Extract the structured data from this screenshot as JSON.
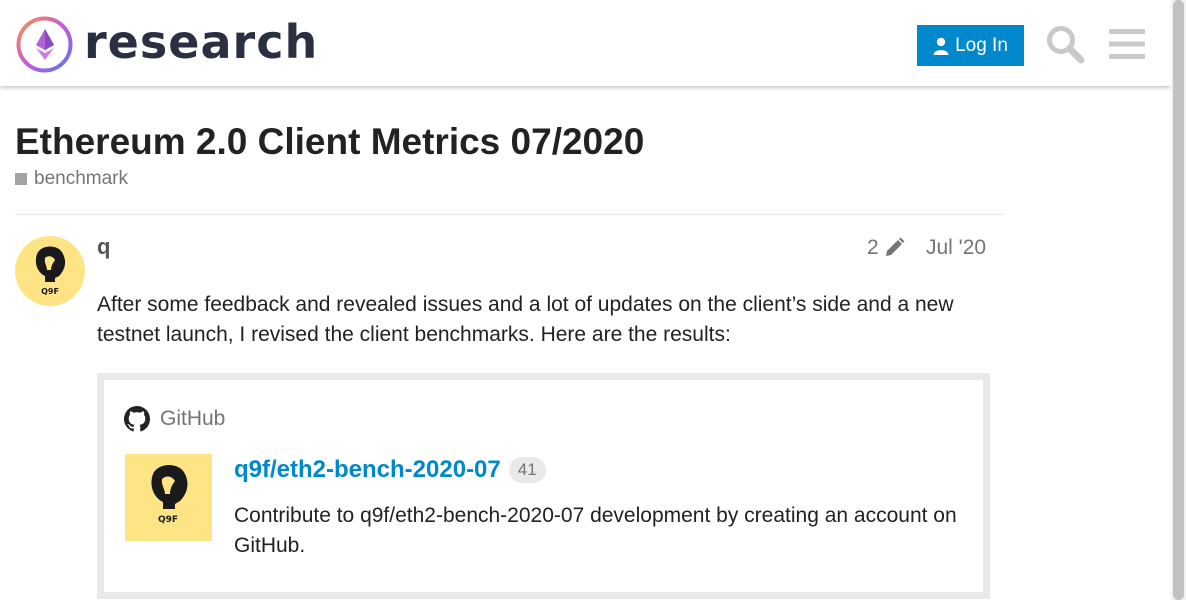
{
  "header": {
    "logo_text": "research",
    "login_label": "Log In",
    "icons": {
      "logo": "ethereum-research-logo",
      "user": "user-icon",
      "search": "search-icon",
      "menu": "hamburger-menu-icon"
    }
  },
  "topic": {
    "title": "Ethereum 2.0 Client Metrics 07/2020",
    "category": "benchmark",
    "category_color": "#a3a3a3"
  },
  "post": {
    "username": "q",
    "edit_count": "2",
    "date": "Jul '20",
    "body": "After some feedback and revealed issues and a lot of updates on the client’s side and a new testnet launch, I revised the client benchmarks. Here are the results:",
    "avatar_text": "Q9F"
  },
  "onebox": {
    "source": "GitHub",
    "repo_title": "q9f/eth2-bench-2020-07",
    "stars": "41",
    "description": "Contribute to q9f/eth2-bench-2020-07 development by creating an account on GitHub.",
    "image_text": "Q9F"
  },
  "colors": {
    "accent": "#0088cc",
    "avatar_bg": "#ffe486",
    "border": "#e9e9e9",
    "muted_text": "#757575"
  }
}
